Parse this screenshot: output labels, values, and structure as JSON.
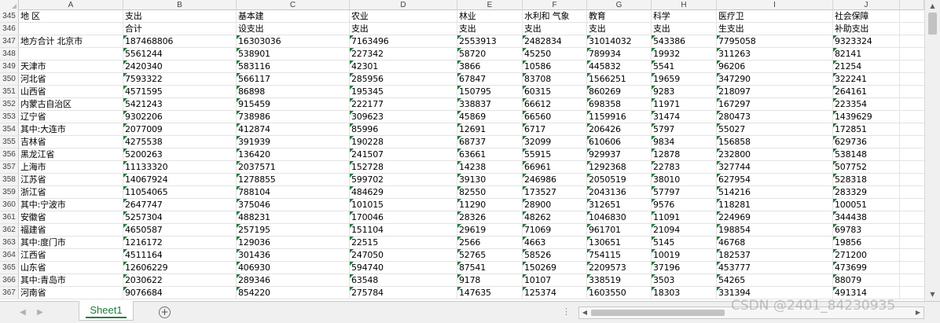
{
  "columns": [
    "A",
    "B",
    "C",
    "D",
    "E",
    "F",
    "G",
    "H",
    "I",
    "J"
  ],
  "header_rows": [
    {
      "num": "345",
      "cells": [
        "地  区",
        "支出",
        "基本建",
        "农业",
        "林业",
        "水利和  气象",
        "教育",
        "科学",
        "医疗卫",
        "社会保障"
      ]
    },
    {
      "num": "346",
      "cells": [
        "",
        "合计",
        "设支出",
        "支出",
        "支出",
        "支出",
        "支出",
        "支出",
        "生支出",
        "补助支出"
      ]
    }
  ],
  "data_rows": [
    {
      "num": "347",
      "cells": [
        "地方合计  北京市",
        "187468806",
        "16303036",
        "7163496",
        "2553913",
        "2482834",
        "31014032",
        "543386",
        "7795058",
        "9323324"
      ]
    },
    {
      "num": "348",
      "cells": [
        "",
        "5561244",
        "538901",
        "227342",
        "58720",
        "45250",
        "789934",
        "19932",
        "311263",
        "82141"
      ]
    },
    {
      "num": "349",
      "cells": [
        "天津市",
        "2420340",
        "583116",
        "42301",
        "3866",
        "10586",
        "445832",
        "5541",
        "96206",
        "21254"
      ]
    },
    {
      "num": "350",
      "cells": [
        "河北省",
        "7593322",
        "566117",
        "285956",
        "67847",
        "83708",
        "1566251",
        "19659",
        "347290",
        "322241"
      ]
    },
    {
      "num": "351",
      "cells": [
        "山西省",
        "4571595",
        "86898",
        "195345",
        "150795",
        "60315",
        "860269",
        "9283",
        "218097",
        "264161"
      ]
    },
    {
      "num": "352",
      "cells": [
        "内蒙古自治区",
        "5421243",
        "915459",
        "222177",
        "338837",
        "66612",
        "698358",
        "11971",
        "167297",
        "223354"
      ]
    },
    {
      "num": "353",
      "cells": [
        "辽宁省",
        "9302206",
        "738986",
        "309623",
        "45869",
        "66560",
        "1159916",
        "31474",
        "280473",
        "1439629"
      ]
    },
    {
      "num": "354",
      "cells": [
        "其中:大连市",
        "2077009",
        "412874",
        "85996",
        "12691",
        "6717",
        "206426",
        "5797",
        "55027",
        "172851"
      ]
    },
    {
      "num": "355",
      "cells": [
        "吉林省",
        "4275538",
        "391939",
        "190228",
        "68737",
        "32099",
        "610606",
        "9834",
        "156858",
        "629736"
      ]
    },
    {
      "num": "356",
      "cells": [
        "黑龙江省",
        "5200263",
        "136420",
        "241507",
        "63661",
        "55915",
        "929937",
        "12878",
        "232800",
        "538148"
      ]
    },
    {
      "num": "357",
      "cells": [
        "上海市",
        "11133320",
        "2037571",
        "152728",
        "14238",
        "66961",
        "1292368",
        "22783",
        "327744",
        "507752"
      ]
    },
    {
      "num": "358",
      "cells": [
        "江苏省",
        "14067924",
        "1278855",
        "599702",
        "39130",
        "246986",
        "2050519",
        "38010",
        "627954",
        "528318"
      ]
    },
    {
      "num": "359",
      "cells": [
        "浙江省",
        "11054065",
        "788104",
        "484629",
        "82550",
        "173527",
        "2043136",
        "57797",
        "514216",
        "283329"
      ]
    },
    {
      "num": "360",
      "cells": [
        "其中:宁波市",
        "2647747",
        "375046",
        "101015",
        "11290",
        "28900",
        "312651",
        "9576",
        "118281",
        "100051"
      ]
    },
    {
      "num": "361",
      "cells": [
        "安徽省",
        "5257304",
        "488231",
        "170046",
        "28326",
        "48262",
        "1046830",
        "11091",
        "224969",
        "344438"
      ]
    },
    {
      "num": "362",
      "cells": [
        "福建省",
        "4650587",
        "257195",
        "151104",
        "29619",
        "71069",
        "961701",
        "21094",
        "198854",
        "69783"
      ]
    },
    {
      "num": "363",
      "cells": [
        "其中:度门市",
        "1216172",
        "129036",
        "22515",
        "2566",
        "4663",
        "130651",
        "5145",
        "46768",
        "19856"
      ]
    },
    {
      "num": "364",
      "cells": [
        "江西省",
        "4511164",
        "301436",
        "247050",
        "52765",
        "58526",
        "754115",
        "10019",
        "182537",
        "271200"
      ]
    },
    {
      "num": "365",
      "cells": [
        "山东省",
        "12606229",
        "406930",
        "594740",
        "87541",
        "150269",
        "2209573",
        "37196",
        "453777",
        "473699"
      ]
    },
    {
      "num": "366",
      "cells": [
        "其中:青岛市",
        "2030622",
        "289346",
        "63548",
        "9178",
        "10107",
        "338519",
        "3503",
        "54265",
        "88079"
      ]
    },
    {
      "num": "367",
      "cells": [
        "河南省",
        "9076684",
        "854220",
        "275784",
        "147635",
        "125374",
        "1603550",
        "18303",
        "331394",
        "491314"
      ]
    }
  ],
  "sheet_tab": "Sheet1",
  "add_sheet_icon": "+",
  "watermark": "CSDN @2401_84230935",
  "colors": {
    "accent": "#1e7b3c",
    "header_bg": "#f3f3f3",
    "grid_line": "#e3e3e3"
  }
}
